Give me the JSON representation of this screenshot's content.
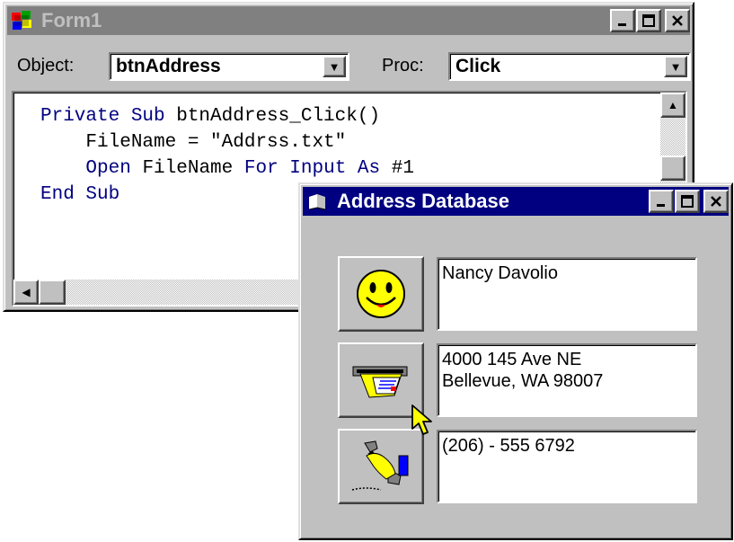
{
  "code_window": {
    "title": "Form1",
    "object_label": "Object:",
    "object_value": "btnAddress",
    "proc_label": "Proc:",
    "proc_value": "Click",
    "code": {
      "line1_kw": "Private Sub",
      "line1_rest": " btnAddress_Click()",
      "line2": "    FileName = \"Addrss.txt\"",
      "line3_indent": "    ",
      "line3_kw1": "Open",
      "line3_mid": " FileName ",
      "line3_kw2": "For Input As",
      "line3_rest": " #1",
      "line4_kw": "End Sub"
    }
  },
  "address_window": {
    "title": "Address Database",
    "name_field": "Nancy Davolio",
    "address_line1": "4000 145 Ave NE",
    "address_line2": "Bellevue, WA  98007",
    "phone_field": "(206) - 555 6792"
  },
  "icons": {
    "form_icon": "vb-form-icon",
    "addr_icon": "app-icon",
    "face": "smiley-face-icon",
    "mail": "envelope-slot-icon",
    "phone": "telephone-icon",
    "cursor": "arrow-cursor-icon"
  },
  "colors": {
    "active_title": "#000080",
    "inactive_title": "#808080",
    "face": "#ffff00",
    "keyword": "#000080"
  }
}
